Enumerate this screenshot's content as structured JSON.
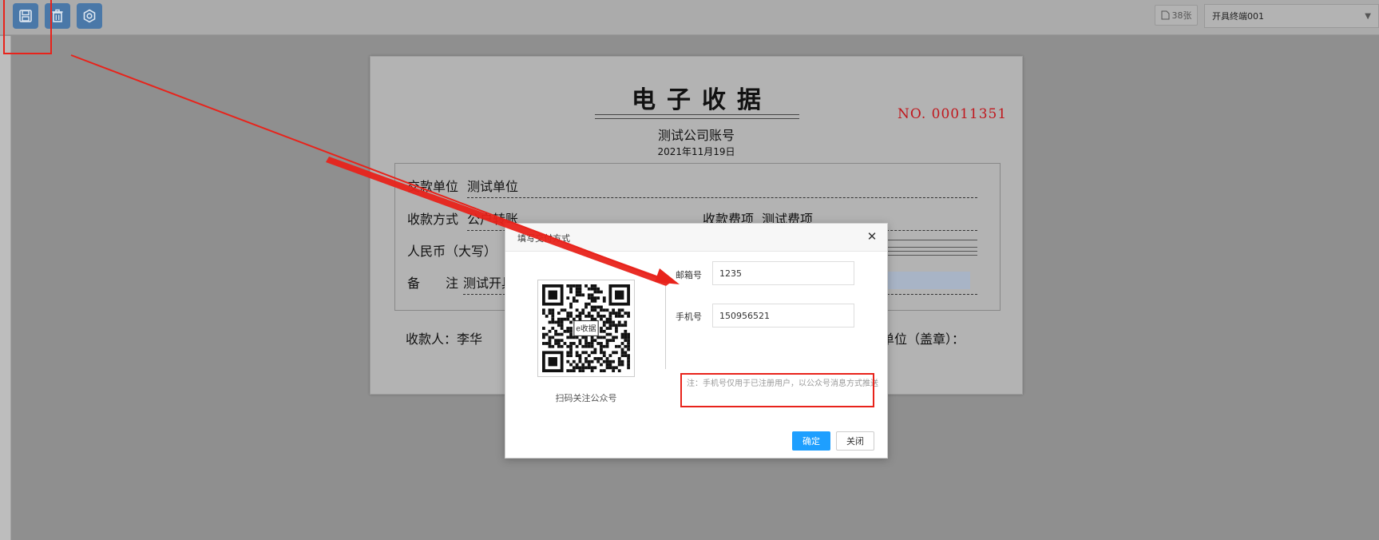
{
  "toolbar": {
    "buttons": [
      {
        "icon": "save-icon"
      },
      {
        "icon": "trash-icon"
      },
      {
        "icon": "settings-icon"
      }
    ],
    "count_label": "38张",
    "terminal_select_value": "开具终端001"
  },
  "receipt": {
    "title": "电子收据",
    "company": "测试公司账号",
    "date": "2021年11月19日",
    "number": "NO. 00011351",
    "fields": {
      "payer_label": "交款单位",
      "payer_value": "测试单位",
      "method_label": "收款方式",
      "method_value": "公户转账",
      "item_label": "收款费项",
      "item_value": "测试费项",
      "amount_label": "人民币（大写）",
      "remark_label": "备　　注",
      "remark_value": "测试开具"
    },
    "footer": {
      "payee": "收款人：李华",
      "unit_stamp": "单位（盖章）："
    },
    "number_color": "#c0171d"
  },
  "dialog": {
    "title": "填写交付方式",
    "qr_caption": "扫码关注公众号",
    "qr_logo_text": "e收据",
    "email_label": "邮箱号",
    "email_value": "1235",
    "phone_label": "手机号",
    "phone_value": "150956521",
    "note": "注：手机号仅用于已注册用户，以公众号消息方式推送",
    "confirm_label": "确定",
    "close_label": "关闭",
    "confirm_color": "#1e9fff"
  },
  "annotations": {
    "color": "#e8231b"
  }
}
